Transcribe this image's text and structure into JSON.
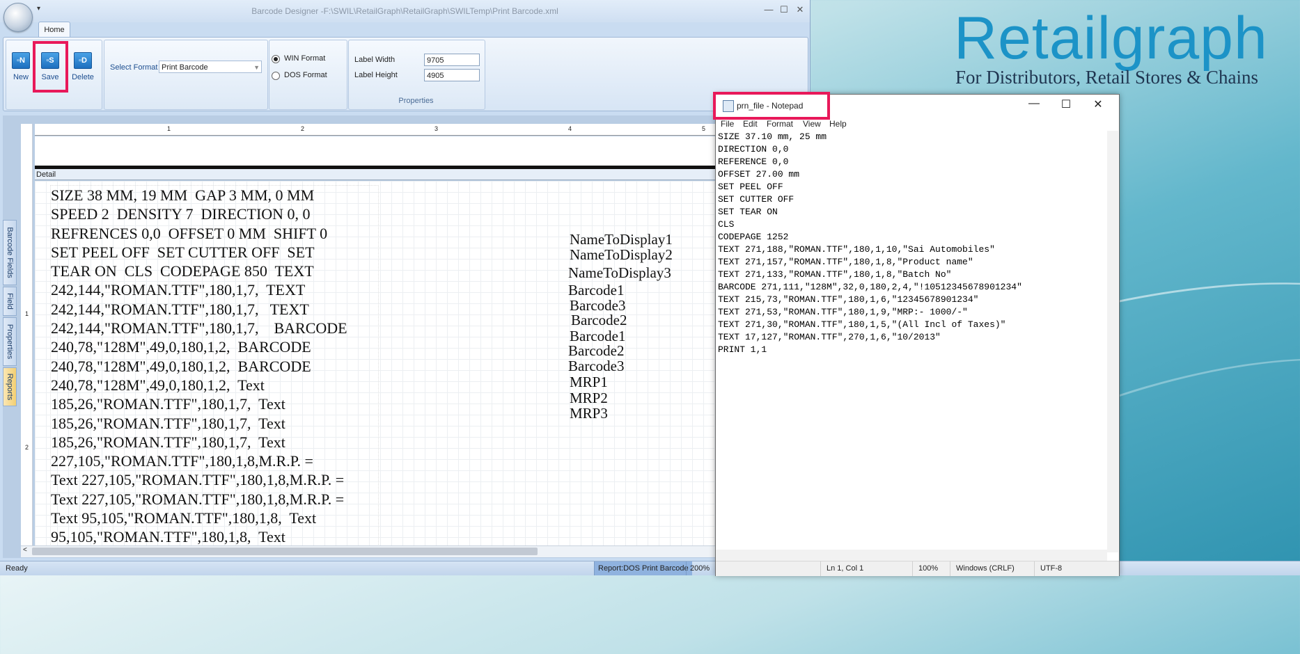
{
  "branding": {
    "logo_text": "Retailgraph",
    "tagline": "For Distributors, Retail Stores & Chains"
  },
  "designer": {
    "window_title": "Barcode Designer -F:\\SWIL\\RetailGraph\\RetailGraph\\SWILTemp\\Print Barcode.xml",
    "quick_access": "▾",
    "tab_home": "Home",
    "buttons": {
      "new": "New",
      "save": "Save",
      "delete": "Delete"
    },
    "button_icons": {
      "new": "new-icon",
      "save": "save-icon",
      "delete": "delete-icon"
    },
    "icon_glyphs": {
      "new": "▫N",
      "save": "▫S",
      "delete": "▫D"
    },
    "select_format_label": "Select Format",
    "select_format_value": "Print Barcode",
    "win_format": "WIN Format",
    "dos_format": "DOS Format",
    "label_width_label": "Label Width",
    "label_width_value": "9705",
    "label_height_label": "Label Height",
    "label_height_value": "4905",
    "properties_caption": "Properties",
    "side_tabs": [
      "Barcode Fields",
      "Field",
      "Properties",
      "Reports"
    ],
    "ruler_numbers": [
      "1",
      "2",
      "3",
      "4",
      "5"
    ],
    "vruler_numbers": [
      "1",
      "2"
    ],
    "detail_band": "Detail",
    "command_text": "SIZE 38 MM, 19 MM  GAP 3 MM, 0 MM\nSPEED 2  DENSITY 7  DIRECTION 0, 0\nREFRENCES 0,0  OFFSET 0 MM  SHIFT 0\nSET PEEL OFF  SET CUTTER OFF  SET\nTEAR ON  CLS  CODEPAGE 850  TEXT\n242,144,\"ROMAN.TTF\",180,1,7,  TEXT\n242,144,\"ROMAN.TTF\",180,1,7,   TEXT\n242,144,\"ROMAN.TTF\",180,1,7,    BARCODE\n240,78,\"128M\",49,0,180,1,2,  BARCODE\n240,78,\"128M\",49,0,180,1,2,  BARCODE\n240,78,\"128M\",49,0,180,1,2,  Text\n185,26,\"ROMAN.TTF\",180,1,7,  Text\n185,26,\"ROMAN.TTF\",180,1,7,  Text\n185,26,\"ROMAN.TTF\",180,1,7,  Text\n227,105,\"ROMAN.TTF\",180,1,8,M.R.P. =\nText 227,105,\"ROMAN.TTF\",180,1,8,M.R.P. =\nText 227,105,\"ROMAN.TTF\",180,1,8,M.R.P. =\nText 95,105,\"ROMAN.TTF\",180,1,8,  Text\n95,105,\"ROMAN.TTF\",180,1,8,  Text",
    "fields": [
      "NameToDisplay1",
      "NameToDisplay2",
      "NameToDisplay3",
      "Barcode1",
      "Barcode3",
      "Barcode2",
      "Barcode1",
      "Barcode2",
      "Barcode3",
      "MRP1",
      "MRP2",
      "MRP3"
    ],
    "status_ready": "Ready",
    "status_report": "Report:DOS Print Barcode",
    "status_zoom": "200%"
  },
  "notepad": {
    "title": "prn_file - Notepad",
    "menu": [
      "File",
      "Edit",
      "Format",
      "View",
      "Help"
    ],
    "content": "SIZE 37.10 mm, 25 mm\nDIRECTION 0,0\nREFERENCE 0,0\nOFFSET 27.00 mm\nSET PEEL OFF\nSET CUTTER OFF\nSET TEAR ON\nCLS\nCODEPAGE 1252\nTEXT 271,188,\"ROMAN.TTF\",180,1,10,\"Sai Automobiles\"\nTEXT 271,157,\"ROMAN.TTF\",180,1,8,\"Product name\"\nTEXT 271,133,\"ROMAN.TTF\",180,1,8,\"Batch No\"\nBARCODE 271,111,\"128M\",32,0,180,2,4,\"!10512345678901234\"\nTEXT 215,73,\"ROMAN.TTF\",180,1,6,\"12345678901234\"\nTEXT 271,53,\"ROMAN.TTF\",180,1,9,\"MRP:- 1000/-\"\nTEXT 271,30,\"ROMAN.TTF\",180,1,5,\"(All Incl of Taxes)\"\nTEXT 17,127,\"ROMAN.TTF\",270,1,6,\"10/2013\"\nPRINT 1,1",
    "status": {
      "position": "Ln 1, Col 1",
      "zoom": "100%",
      "line_ending": "Windows (CRLF)",
      "encoding": "UTF-8"
    },
    "controls": {
      "minimize": "—",
      "maximize": "☐",
      "close": "✕"
    }
  },
  "colors": {
    "highlight": "#e8195a",
    "brand": "#1c93c7"
  }
}
